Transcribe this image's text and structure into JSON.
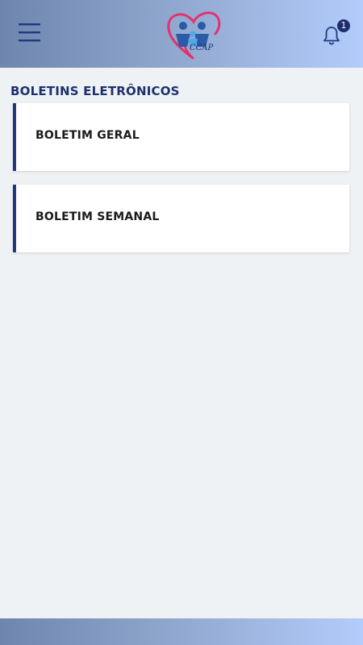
{
  "header": {
    "logo_text": "CCAP",
    "notification_count": "1",
    "icons": {
      "menu": "hamburger-menu-icon",
      "logo": "heart-family-logo",
      "notifications": "bell-icon"
    }
  },
  "main": {
    "section_title": "BOLETINS ELETRÔNICOS",
    "cards": [
      {
        "label": "BOLETIM GERAL"
      },
      {
        "label": "BOLETIM SEMANAL"
      }
    ]
  },
  "colors": {
    "accent": "#1d3a83",
    "title": "#1d2f6f",
    "logo_heart": "#e2326e",
    "logo_figures": "#2a5aa8"
  }
}
